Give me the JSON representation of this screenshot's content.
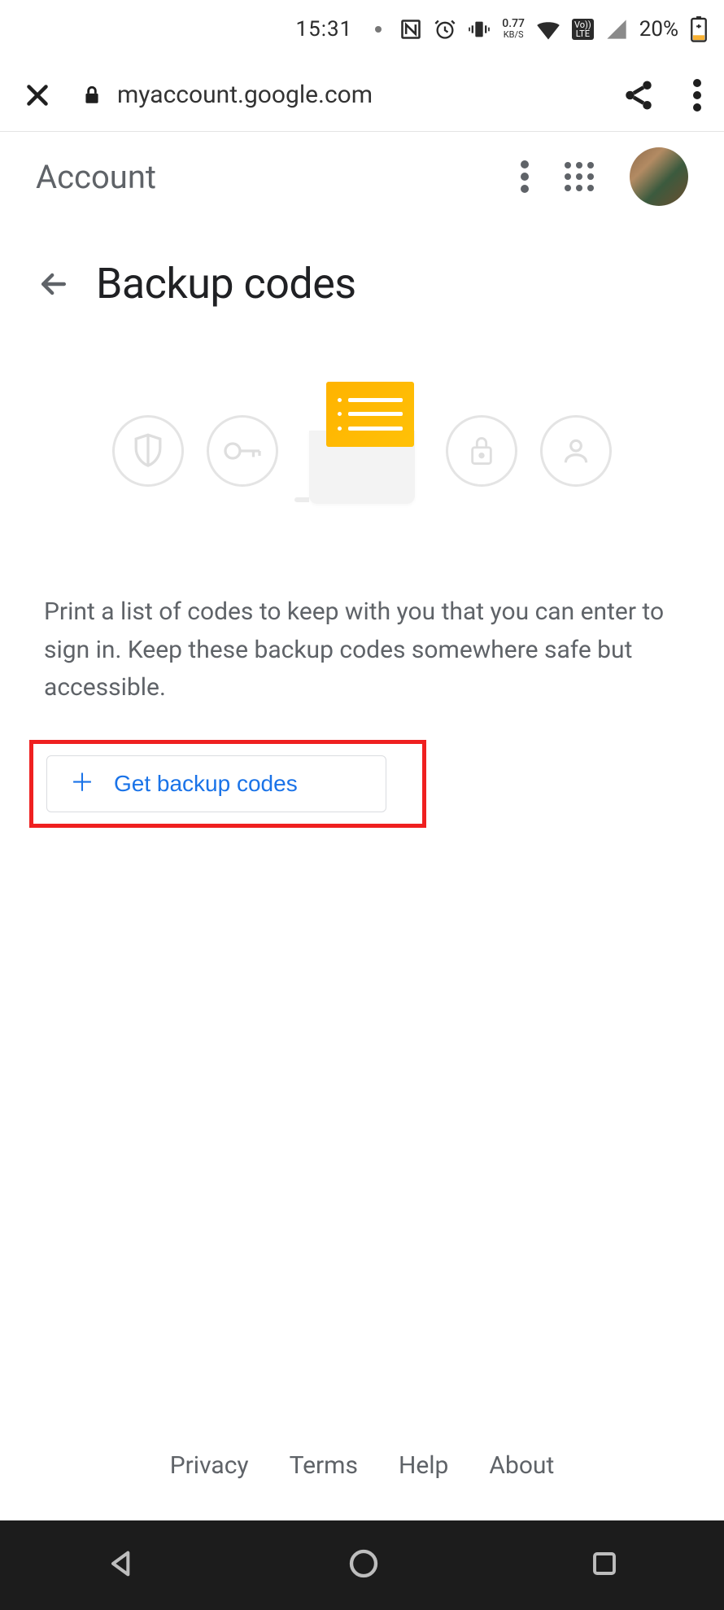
{
  "status_bar": {
    "time": "15:31",
    "data_rate_value": "0.77",
    "data_rate_unit": "KB/S",
    "volte_top": "Vo))",
    "volte_bottom": "LTE",
    "battery_percent": "20%"
  },
  "browser": {
    "url": "myaccount.google.com"
  },
  "account_header": {
    "title": "Account"
  },
  "page": {
    "heading": "Backup codes",
    "description": "Print a list of codes to keep with you that you can enter to sign in. Keep these backup codes some­where safe but accessible.",
    "get_codes_label": "Get backup codes"
  },
  "footer": {
    "privacy": "Privacy",
    "terms": "Terms",
    "help": "Help",
    "about": "About"
  }
}
